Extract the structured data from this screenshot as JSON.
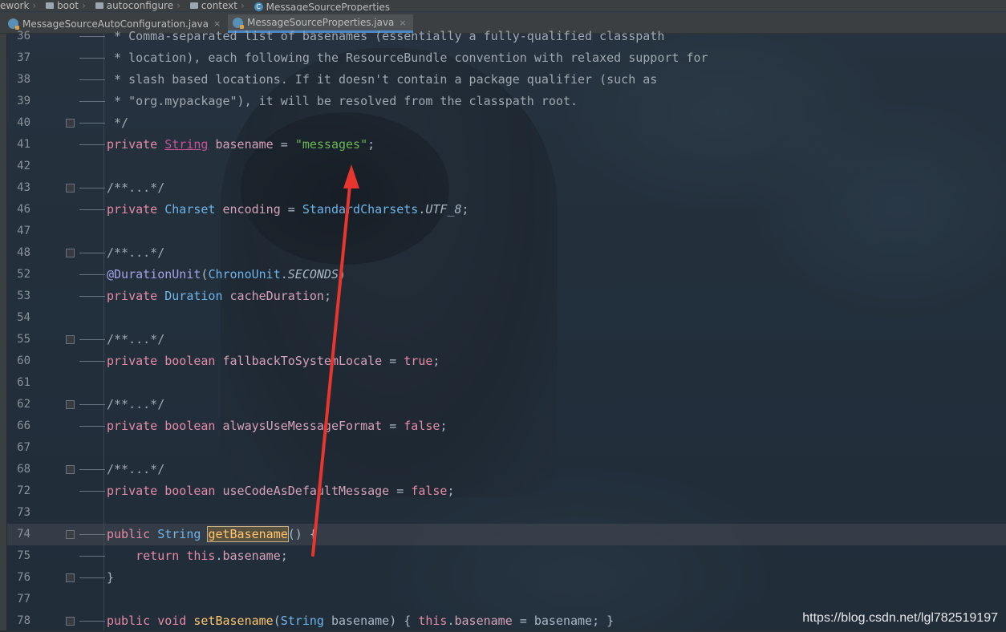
{
  "breadcrumb": {
    "items": [
      {
        "label": "ework",
        "icon": "none"
      },
      {
        "label": "boot",
        "icon": "folder-icon"
      },
      {
        "label": "autoconfigure",
        "icon": "folder-icon"
      },
      {
        "label": "context",
        "icon": "folder-icon"
      },
      {
        "label": "MessageSourceProperties",
        "icon": "class-icon"
      }
    ]
  },
  "tabs": [
    {
      "label": "MessageSourceAutoConfiguration.java",
      "close": "×",
      "active": false
    },
    {
      "label": "MessageSourceProperties.java",
      "close": "×",
      "active": true
    }
  ],
  "editor": {
    "lines": [
      {
        "no": "36",
        "text": " * Comma-separated list of basenames (essentially a fully-qualified classpath"
      },
      {
        "no": "37",
        "text": " * location), each following the ResourceBundle convention with relaxed support for"
      },
      {
        "no": "38",
        "text": " * slash based locations. If it doesn't contain a package qualifier (such as"
      },
      {
        "no": "39",
        "text": " * \"org.mypackage\"), it will be resolved from the classpath root."
      },
      {
        "no": "40",
        "text": " */"
      },
      {
        "no": "41",
        "kw1": "private",
        "type": "String",
        "name": "basename",
        "op": " = ",
        "str": "\"messages\"",
        "end": ";"
      },
      {
        "no": "42"
      },
      {
        "no": "43",
        "text": "/**...*/"
      },
      {
        "no": "46",
        "kw1": "private",
        "type": "Charset",
        "name": "encoding",
        "op": " = ",
        "cls": "StandardCharsets",
        "dot": ".",
        "const": "UTF_8",
        "end": ";"
      },
      {
        "no": "47"
      },
      {
        "no": "48",
        "text": "/**...*/"
      },
      {
        "no": "52",
        "anno": "@DurationUnit",
        "paren_open": "(",
        "cls": "ChronoUnit",
        "dot": ".",
        "const": "SECONDS",
        "paren_close": ")"
      },
      {
        "no": "53",
        "kw1": "private",
        "type": "Duration",
        "name": "cacheDuration",
        "end": ";"
      },
      {
        "no": "54"
      },
      {
        "no": "55",
        "text": "/**...*/"
      },
      {
        "no": "60",
        "kw1": "private",
        "kw2": "boolean",
        "name": "fallbackToSystemLocale",
        "op": " = ",
        "val": "true",
        "end": ";"
      },
      {
        "no": "61"
      },
      {
        "no": "62",
        "text": "/**...*/"
      },
      {
        "no": "66",
        "kw1": "private",
        "kw2": "boolean",
        "name": "alwaysUseMessageFormat",
        "op": " = ",
        "val": "false",
        "end": ";"
      },
      {
        "no": "67"
      },
      {
        "no": "68",
        "text": "/**...*/"
      },
      {
        "no": "72",
        "kw1": "private",
        "kw2": "boolean",
        "name": "useCodeAsDefaultMessage",
        "op": " = ",
        "val": "false",
        "end": ";"
      },
      {
        "no": "73"
      },
      {
        "no": "74",
        "kw1": "public",
        "type": "String",
        "method": "getBasename",
        "rest": "() {"
      },
      {
        "no": "75",
        "kw1": "return",
        "kw2": "this",
        "dot": ".",
        "field": "basename",
        "end": ";"
      },
      {
        "no": "76",
        "text": "}"
      },
      {
        "no": "77"
      },
      {
        "no": "78",
        "kw1": "public",
        "kw2": "void",
        "method": "setBasename",
        "paren_open": "(",
        "type": "String",
        "param": "basename",
        "paren_close": ") { ",
        "kw3": "this",
        "dot": ".",
        "field": "basename",
        "op": " = ",
        "param2": "basename",
        "end": "; }"
      }
    ]
  },
  "watermark": "https://blog.csdn.net/lgl782519197",
  "colors": {
    "keyword": "#e58ba4",
    "type": "#6fb4e8",
    "string": "#6ab855",
    "annotation": "#a5a3e6",
    "method": "#ffc66d",
    "arrow": "#e8352e"
  }
}
